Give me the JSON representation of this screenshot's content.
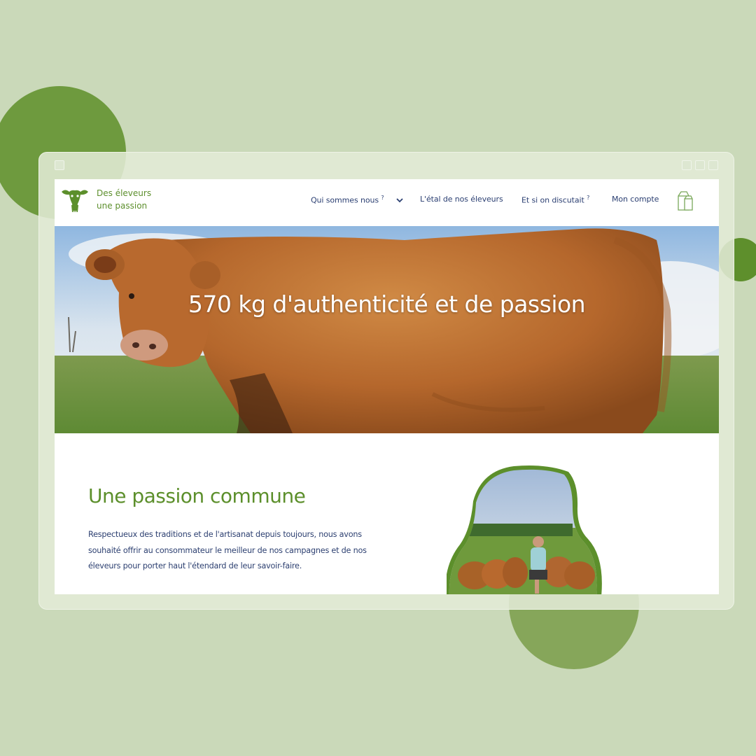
{
  "site": {
    "logo_line1": "Des éleveurs",
    "logo_line2": "une passion"
  },
  "nav": {
    "items": [
      {
        "label": "Qui sommes nous",
        "suffix": "?",
        "has_dropdown": true
      },
      {
        "label": "L'étal de nos éleveurs"
      },
      {
        "label": "Et si on discutait",
        "suffix": "?"
      },
      {
        "label": "Mon compte"
      }
    ],
    "cart_icon": "milk-carton-icon",
    "dropdown_icon": "chevron-down-icon"
  },
  "hero": {
    "title": "570 kg d'authenticité et de passion"
  },
  "section": {
    "title": "Une passion commune",
    "text": "Respectueux des traditions et de l'artisanat depuis toujours, nous avons souhaité offrir au consommateur le meilleur de nos campagnes et de nos éleveurs pour porter haut l'étendard de leur savoir-faire."
  },
  "colors": {
    "background": "#cad9b9",
    "brand_green": "#5c8f2b",
    "nav_text": "#2b3f72",
    "cow_brown": "#b8692e"
  }
}
